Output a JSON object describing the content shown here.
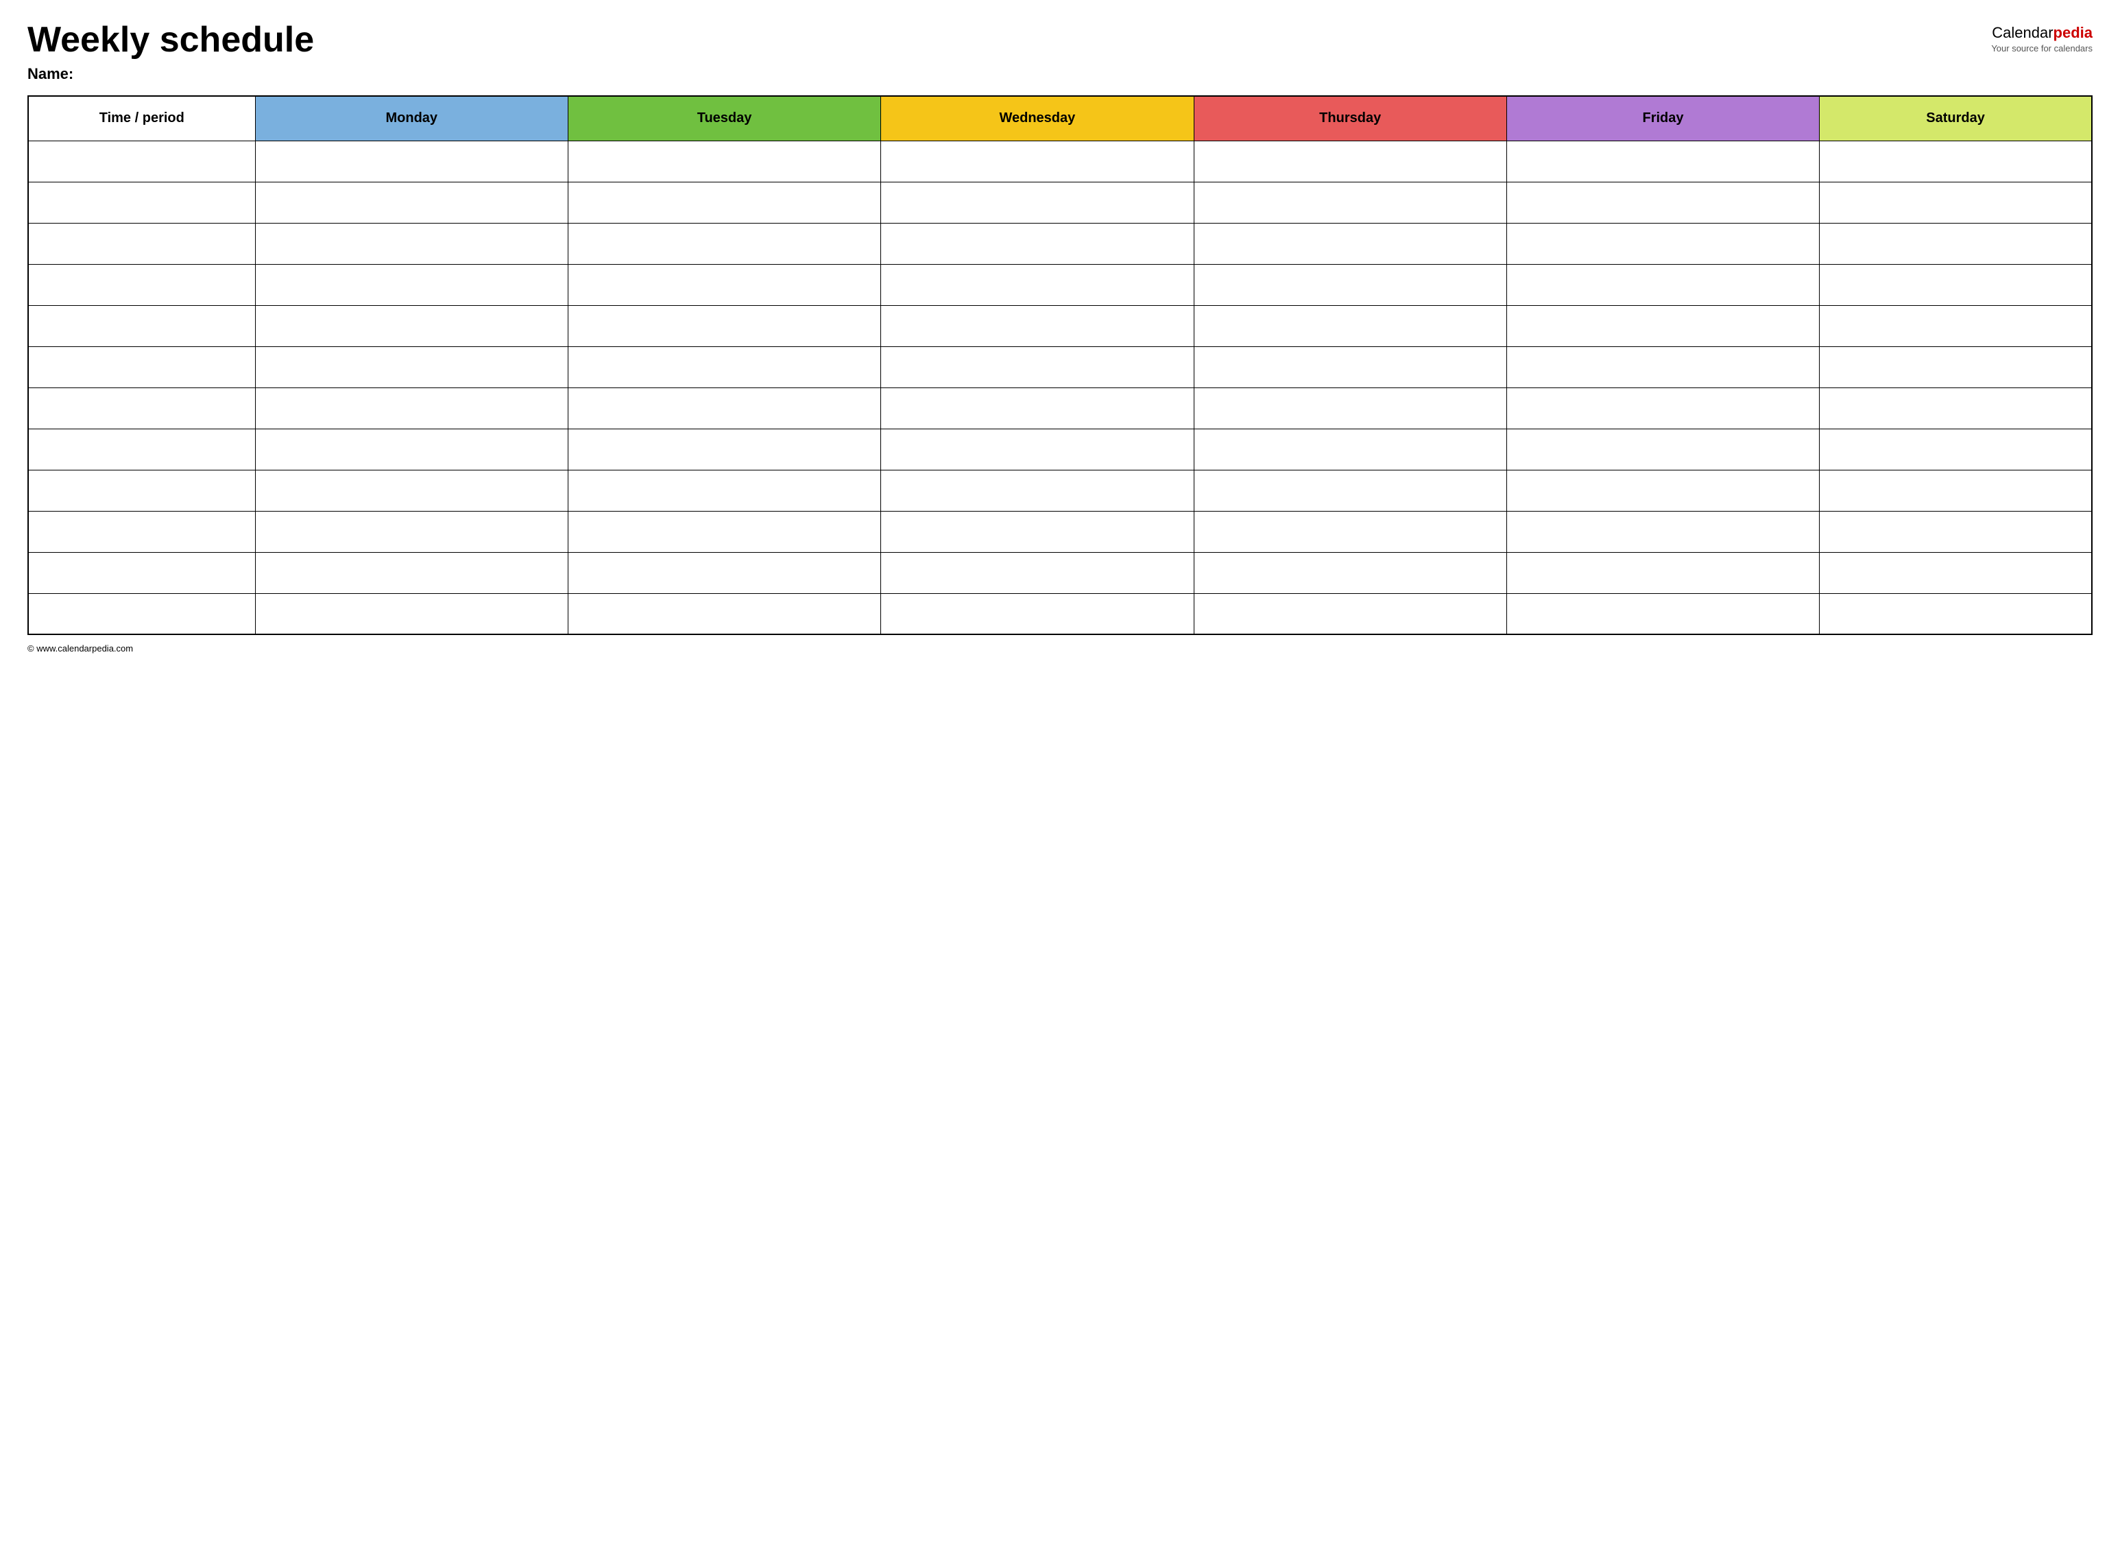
{
  "header": {
    "title": "Weekly schedule",
    "name_label": "Name:",
    "logo": {
      "calendar_part": "Calendar",
      "pedia_part": "pedia",
      "tagline": "Your source for calendars"
    }
  },
  "table": {
    "columns": [
      {
        "id": "time",
        "label": "Time / period",
        "color_class": "col-time"
      },
      {
        "id": "monday",
        "label": "Monday",
        "color_class": "col-monday"
      },
      {
        "id": "tuesday",
        "label": "Tuesday",
        "color_class": "col-tuesday"
      },
      {
        "id": "wednesday",
        "label": "Wednesday",
        "color_class": "col-wednesday"
      },
      {
        "id": "thursday",
        "label": "Thursday",
        "color_class": "col-thursday"
      },
      {
        "id": "friday",
        "label": "Friday",
        "color_class": "col-friday"
      },
      {
        "id": "saturday",
        "label": "Saturday",
        "color_class": "col-saturday"
      }
    ],
    "row_count": 12
  },
  "footer": {
    "url": "www.calendarpedia.com",
    "full_url": "© www.calendarpedia.com"
  }
}
